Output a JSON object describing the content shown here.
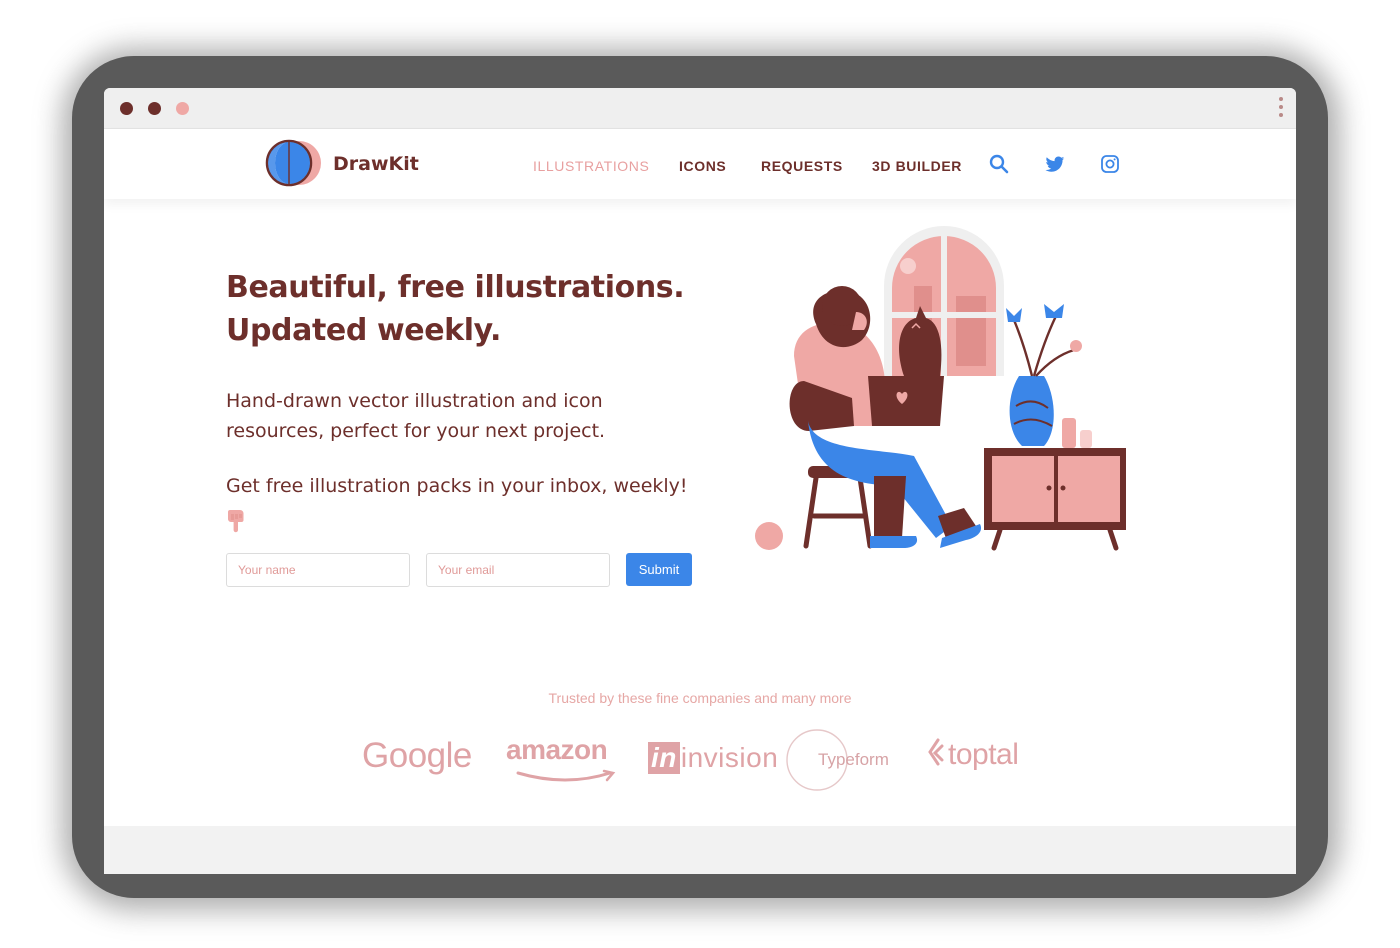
{
  "window": {
    "controls": [
      "close",
      "minimize",
      "maximize"
    ],
    "menu_icon": "kebab-menu-icon"
  },
  "header": {
    "brand": "DrawKit",
    "nav": [
      {
        "label": "ILLUSTRATIONS",
        "active": true
      },
      {
        "label": "ICONS",
        "active": false
      },
      {
        "label": "REQUESTS",
        "active": false
      },
      {
        "label": "3D BUILDER",
        "active": false
      }
    ],
    "icons": [
      "search-icon",
      "twitter-icon",
      "instagram-icon"
    ]
  },
  "hero": {
    "title_line1": "Beautiful, free illustrations.",
    "title_line2": "Updated weekly.",
    "subtitle_line1": "Hand-drawn vector illustration and icon",
    "subtitle_line2": "resources, perfect for your next project.",
    "newsletter_text": "Get free illustration packs in your inbox, weekly!",
    "form": {
      "name_placeholder": "Your name",
      "email_placeholder": "Your email",
      "submit_label": "Submit"
    }
  },
  "trusted": {
    "label": "Trusted by these fine companies and many more",
    "logos": [
      "Google",
      "amazon",
      "invision",
      "Typeform",
      "toptal"
    ]
  },
  "colors": {
    "brand_brown": "#6d2f2b",
    "pink": "#efa8a5",
    "blue": "#3b86e8",
    "logo_pink": "#dfa3a6"
  }
}
